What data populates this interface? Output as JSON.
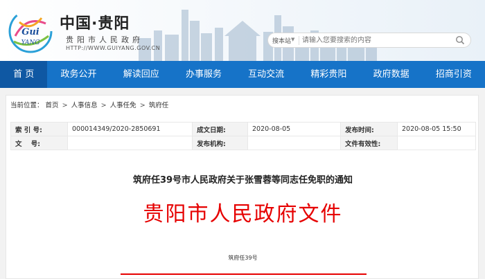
{
  "header": {
    "site_title": "中国·贵阳",
    "site_subtitle": "贵阳市人民政府",
    "site_url": "HTTP://WWW.GUIYANG.GOV.CN"
  },
  "search": {
    "scope": "搜本站",
    "placeholder": "请输入您要搜索的内容"
  },
  "nav": {
    "items": [
      {
        "label": "首 页"
      },
      {
        "label": "政务公开"
      },
      {
        "label": "解读回应"
      },
      {
        "label": "办事服务"
      },
      {
        "label": "互动交流"
      },
      {
        "label": "精彩贵阳"
      },
      {
        "label": "政府数据"
      },
      {
        "label": "招商引资"
      }
    ]
  },
  "breadcrumb": {
    "prefix": "当前位置：",
    "items": [
      "首页",
      "人事信息",
      "人事任免",
      "筑府任"
    ],
    "separator": ">"
  },
  "meta": {
    "index_label": "索 引 号:",
    "index_value": "000014349/2020-2850691",
    "date_label": "成文日期:",
    "date_value": "2020-08-05",
    "publish_time_label": "发布时间:",
    "publish_time_value": "2020-08-05 15:50",
    "doc_no_label": "文    号:",
    "doc_no_value": "",
    "org_label": "发布机构:",
    "org_value": "",
    "validity_label": "文件有效性:",
    "validity_value": ""
  },
  "document": {
    "title": "筑府任39号市人民政府关于张雪蓉等同志任免职的通知",
    "header": "贵阳市人民政府文件",
    "number": "筑府任39号"
  },
  "colors": {
    "nav_bg": "#1673c8",
    "nav_active": "#0f58a3",
    "doc_red": "#e60000"
  }
}
